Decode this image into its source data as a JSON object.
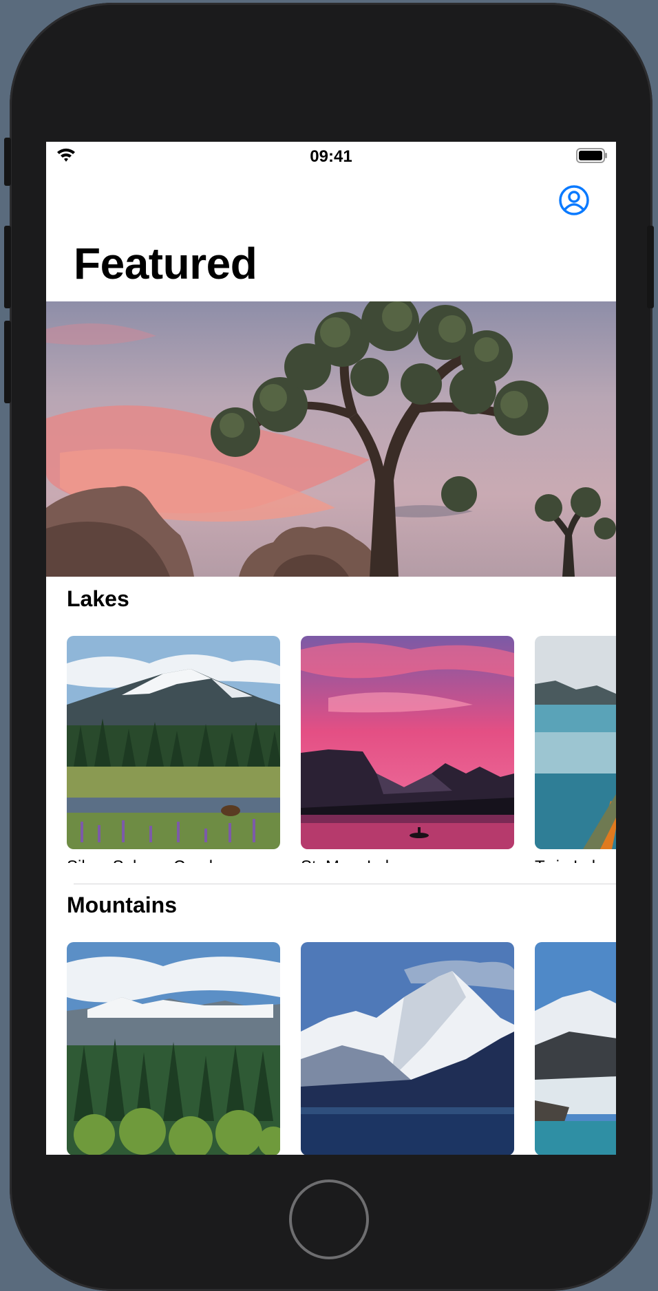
{
  "status_bar": {
    "time": "09:41"
  },
  "header": {
    "title": "Featured",
    "profile_icon": "person-circle-icon"
  },
  "colors": {
    "accent": "#0a7aff",
    "background": "#ffffff",
    "device": "#1b1b1c"
  },
  "sections": [
    {
      "title": "Lakes",
      "items": [
        {
          "name": "Silver Salmon Creek"
        },
        {
          "name": "St. Mary Lake"
        },
        {
          "name": "Twin Lake"
        }
      ]
    },
    {
      "title": "Mountains",
      "items": [
        {
          "name": ""
        },
        {
          "name": ""
        },
        {
          "name": ""
        }
      ]
    }
  ]
}
